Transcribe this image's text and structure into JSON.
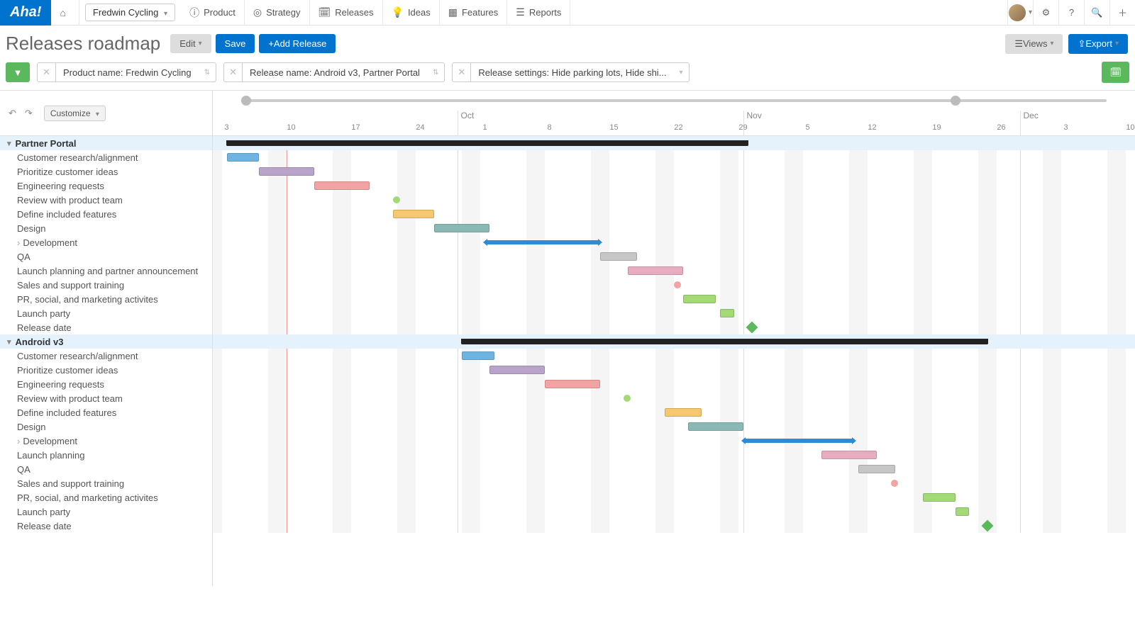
{
  "logo": "Aha!",
  "product_selector": "Fredwin Cycling",
  "nav": {
    "home": "",
    "product": "Product",
    "strategy": "Strategy",
    "releases": "Releases",
    "ideas": "Ideas",
    "features": "Features",
    "reports": "Reports"
  },
  "page_title": "Releases roadmap",
  "toolbar": {
    "edit": "Edit",
    "save": "Save",
    "add_release": "Add Release",
    "views": "Views",
    "export": "Export"
  },
  "filters": {
    "product": "Product name: Fredwin Cycling",
    "release": "Release name: Android v3, Partner Portal",
    "settings": "Release settings: Hide parking lots, Hide shi..."
  },
  "controls": {
    "customize": "Customize"
  },
  "timeline": {
    "months": [
      {
        "label": "Oct",
        "left_pct": 26.5
      },
      {
        "label": "Nov",
        "left_pct": 57.5
      },
      {
        "label": "Dec",
        "left_pct": 87.5
      }
    ],
    "days": [
      {
        "label": "3",
        "left_pct": 1.5
      },
      {
        "label": "10",
        "left_pct": 8.5
      },
      {
        "label": "17",
        "left_pct": 15.5
      },
      {
        "label": "24",
        "left_pct": 22.5
      },
      {
        "label": "1",
        "left_pct": 29.5
      },
      {
        "label": "8",
        "left_pct": 36.5
      },
      {
        "label": "15",
        "left_pct": 43.5
      },
      {
        "label": "22",
        "left_pct": 50.5
      },
      {
        "label": "29",
        "left_pct": 57.5
      },
      {
        "label": "5",
        "left_pct": 64.5
      },
      {
        "label": "12",
        "left_pct": 71.5
      },
      {
        "label": "19",
        "left_pct": 78.5
      },
      {
        "label": "26",
        "left_pct": 85.5
      },
      {
        "label": "3",
        "left_pct": 92.5
      },
      {
        "label": "10",
        "left_pct": 99.5
      }
    ],
    "weekends": [
      {
        "left_pct": -1.0,
        "width_pct": 2
      },
      {
        "left_pct": 6.0,
        "width_pct": 2
      },
      {
        "left_pct": 13.0,
        "width_pct": 2
      },
      {
        "left_pct": 20.0,
        "width_pct": 2
      },
      {
        "left_pct": 27.0,
        "width_pct": 2
      },
      {
        "left_pct": 34.0,
        "width_pct": 2
      },
      {
        "left_pct": 41.0,
        "width_pct": 2
      },
      {
        "left_pct": 48.0,
        "width_pct": 2
      },
      {
        "left_pct": 55.0,
        "width_pct": 2
      },
      {
        "left_pct": 62.0,
        "width_pct": 2
      },
      {
        "left_pct": 69.0,
        "width_pct": 2
      },
      {
        "left_pct": 76.0,
        "width_pct": 2
      },
      {
        "left_pct": 83.0,
        "width_pct": 2
      },
      {
        "left_pct": 90.0,
        "width_pct": 2
      },
      {
        "left_pct": 97.0,
        "width_pct": 2
      }
    ],
    "today_pct": 8.0
  },
  "groups": [
    {
      "name": "Partner Portal",
      "summary": {
        "left_pct": 1.5,
        "width_pct": 56.5
      },
      "tasks": [
        {
          "name": "Customer research/alignment",
          "type": "bar",
          "left_pct": 1.5,
          "width_pct": 3.5,
          "color": "#6fb3e0"
        },
        {
          "name": "Prioritize customer ideas",
          "type": "bar",
          "left_pct": 5.0,
          "width_pct": 6.0,
          "color": "#b9a3c9"
        },
        {
          "name": "Engineering requests",
          "type": "bar",
          "left_pct": 11.0,
          "width_pct": 6.0,
          "color": "#f2a3a3"
        },
        {
          "name": "Review with product team",
          "type": "dot",
          "left_pct": 19.5,
          "color": "#a3d977"
        },
        {
          "name": "Define included features",
          "type": "bar",
          "left_pct": 19.5,
          "width_pct": 4.5,
          "color": "#f5c76e"
        },
        {
          "name": "Design",
          "type": "bar",
          "left_pct": 24.0,
          "width_pct": 6.0,
          "color": "#8ab9b5"
        },
        {
          "name": "Development",
          "type": "dev",
          "left_pct": 29.5,
          "width_pct": 12.5,
          "sub": true
        },
        {
          "name": "QA",
          "type": "bar",
          "left_pct": 42.0,
          "width_pct": 4.0,
          "color": "#c6c6c6"
        },
        {
          "name": "Launch planning and partner announcement",
          "type": "bar",
          "left_pct": 45.0,
          "width_pct": 6.0,
          "color": "#e8acc0"
        },
        {
          "name": "Sales and support training",
          "type": "dot",
          "left_pct": 50.0,
          "color": "#f2a3a3"
        },
        {
          "name": "PR, social, and marketing activites",
          "type": "bar",
          "left_pct": 51.0,
          "width_pct": 3.5,
          "color": "#a3d977"
        },
        {
          "name": "Launch party",
          "type": "bar",
          "left_pct": 55.0,
          "width_pct": 1.5,
          "color": "#a3d977"
        },
        {
          "name": "Release date",
          "type": "milestone",
          "left_pct": 58.0
        }
      ]
    },
    {
      "name": "Android v3",
      "summary": {
        "left_pct": 27.0,
        "width_pct": 57.0
      },
      "tasks": [
        {
          "name": "Customer research/alignment",
          "type": "bar",
          "left_pct": 27.0,
          "width_pct": 3.5,
          "color": "#6fb3e0"
        },
        {
          "name": "Prioritize customer ideas",
          "type": "bar",
          "left_pct": 30.0,
          "width_pct": 6.0,
          "color": "#b9a3c9"
        },
        {
          "name": "Engineering requests",
          "type": "bar",
          "left_pct": 36.0,
          "width_pct": 6.0,
          "color": "#f2a3a3"
        },
        {
          "name": "Review with product team",
          "type": "dot",
          "left_pct": 44.5,
          "color": "#a3d977"
        },
        {
          "name": "Define included features",
          "type": "bar",
          "left_pct": 49.0,
          "width_pct": 4.0,
          "color": "#f5c76e"
        },
        {
          "name": "Design",
          "type": "bar",
          "left_pct": 51.5,
          "width_pct": 6.0,
          "color": "#8ab9b5"
        },
        {
          "name": "Development",
          "type": "dev",
          "left_pct": 57.5,
          "width_pct": 12.0,
          "sub": true
        },
        {
          "name": "Launch planning",
          "type": "bar",
          "left_pct": 66.0,
          "width_pct": 6.0,
          "color": "#e8acc0"
        },
        {
          "name": "QA",
          "type": "bar",
          "left_pct": 70.0,
          "width_pct": 4.0,
          "color": "#c6c6c6"
        },
        {
          "name": "Sales and support training",
          "type": "dot",
          "left_pct": 73.5,
          "color": "#f2a3a3"
        },
        {
          "name": "PR, social, and marketing activites",
          "type": "bar",
          "left_pct": 77.0,
          "width_pct": 3.5,
          "color": "#a3d977"
        },
        {
          "name": "Launch party",
          "type": "bar",
          "left_pct": 80.5,
          "width_pct": 1.5,
          "color": "#a3d977"
        },
        {
          "name": "Release date",
          "type": "milestone",
          "left_pct": 83.5
        }
      ]
    }
  ]
}
